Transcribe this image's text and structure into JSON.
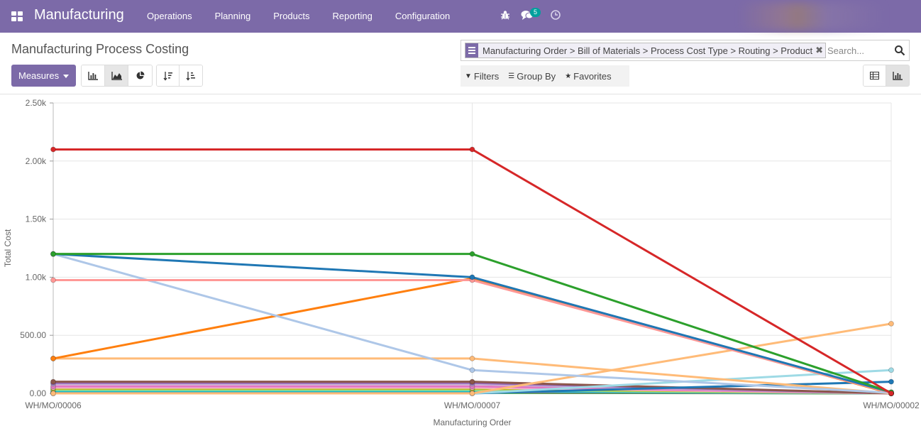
{
  "app": {
    "title": "Manufacturing"
  },
  "menu": [
    "Operations",
    "Planning",
    "Products",
    "Reporting",
    "Configuration"
  ],
  "systray": {
    "debug_icon": "bug-icon",
    "messages_icon": "comments-icon",
    "messages_count": "5",
    "activity_icon": "clock-icon"
  },
  "page": {
    "title": "Manufacturing Process Costing"
  },
  "toolbar": {
    "measures_label": "Measures",
    "chart_type_buttons": [
      "bar-chart-icon",
      "line-chart-icon",
      "pie-chart-icon"
    ],
    "active_chart_type": "line",
    "sort_buttons": [
      "sort-descending-icon",
      "sort-ascending-icon"
    ]
  },
  "search": {
    "facet_values": "Manufacturing Order > Bill of Materials > Process Cost Type > Routing > Product",
    "placeholder": "Search..."
  },
  "filters": {
    "filters_label": "Filters",
    "groupby_label": "Group By",
    "favorites_label": "Favorites"
  },
  "views": {
    "options": [
      "list-view-icon",
      "graph-view-icon"
    ],
    "active": "graph"
  },
  "chart_data": {
    "type": "line",
    "xlabel": "Manufacturing Order",
    "ylabel": "Total Cost",
    "categories": [
      "WH/MO/00006",
      "WH/MO/00007",
      "WH/MO/00002"
    ],
    "ylim": [
      0,
      2500
    ],
    "yticks": [
      "0.00",
      "500.00",
      "1.00k",
      "1.50k",
      "2.00k",
      "2.50k"
    ],
    "ytick_values": [
      0,
      500,
      1000,
      1500,
      2000,
      2500
    ],
    "grid": true,
    "series": [
      {
        "color": "#d62728",
        "values": [
          2100,
          2100,
          0
        ]
      },
      {
        "color": "#2ca02c",
        "values": [
          1200,
          1200,
          10
        ]
      },
      {
        "color": "#1f77b4",
        "values": [
          1200,
          1000,
          10
        ]
      },
      {
        "color": "#ff9896",
        "values": [
          975,
          975,
          5
        ]
      },
      {
        "color": "#aec7e8",
        "values": [
          1200,
          200,
          5
        ]
      },
      {
        "color": "#ff7f0e",
        "values": [
          300,
          990,
          0
        ]
      },
      {
        "color": "#ffbb78",
        "values": [
          300,
          300,
          0
        ]
      },
      {
        "color": "#ffbb78",
        "values": [
          0,
          0,
          600
        ]
      },
      {
        "color": "#9edae5",
        "values": [
          0,
          0,
          200
        ]
      },
      {
        "color": "#1f77b4",
        "values": [
          0,
          0,
          100
        ]
      },
      {
        "color": "#8c564b",
        "values": [
          100,
          100,
          0
        ]
      },
      {
        "color": "#9467bd",
        "values": [
          90,
          90,
          0
        ]
      },
      {
        "color": "#c5b0d5",
        "values": [
          80,
          80,
          0
        ]
      },
      {
        "color": "#e377c2",
        "values": [
          60,
          60,
          0
        ]
      },
      {
        "color": "#f7b6d2",
        "values": [
          50,
          50,
          0
        ]
      },
      {
        "color": "#bcbd22",
        "values": [
          40,
          40,
          0
        ]
      },
      {
        "color": "#98df8a",
        "values": [
          30,
          30,
          0
        ]
      },
      {
        "color": "#17becf",
        "values": [
          20,
          20,
          0
        ]
      },
      {
        "color": "#7f7f7f",
        "values": [
          10,
          10,
          0
        ]
      },
      {
        "color": "#2ca02c",
        "values": [
          5,
          5,
          0
        ]
      }
    ]
  }
}
